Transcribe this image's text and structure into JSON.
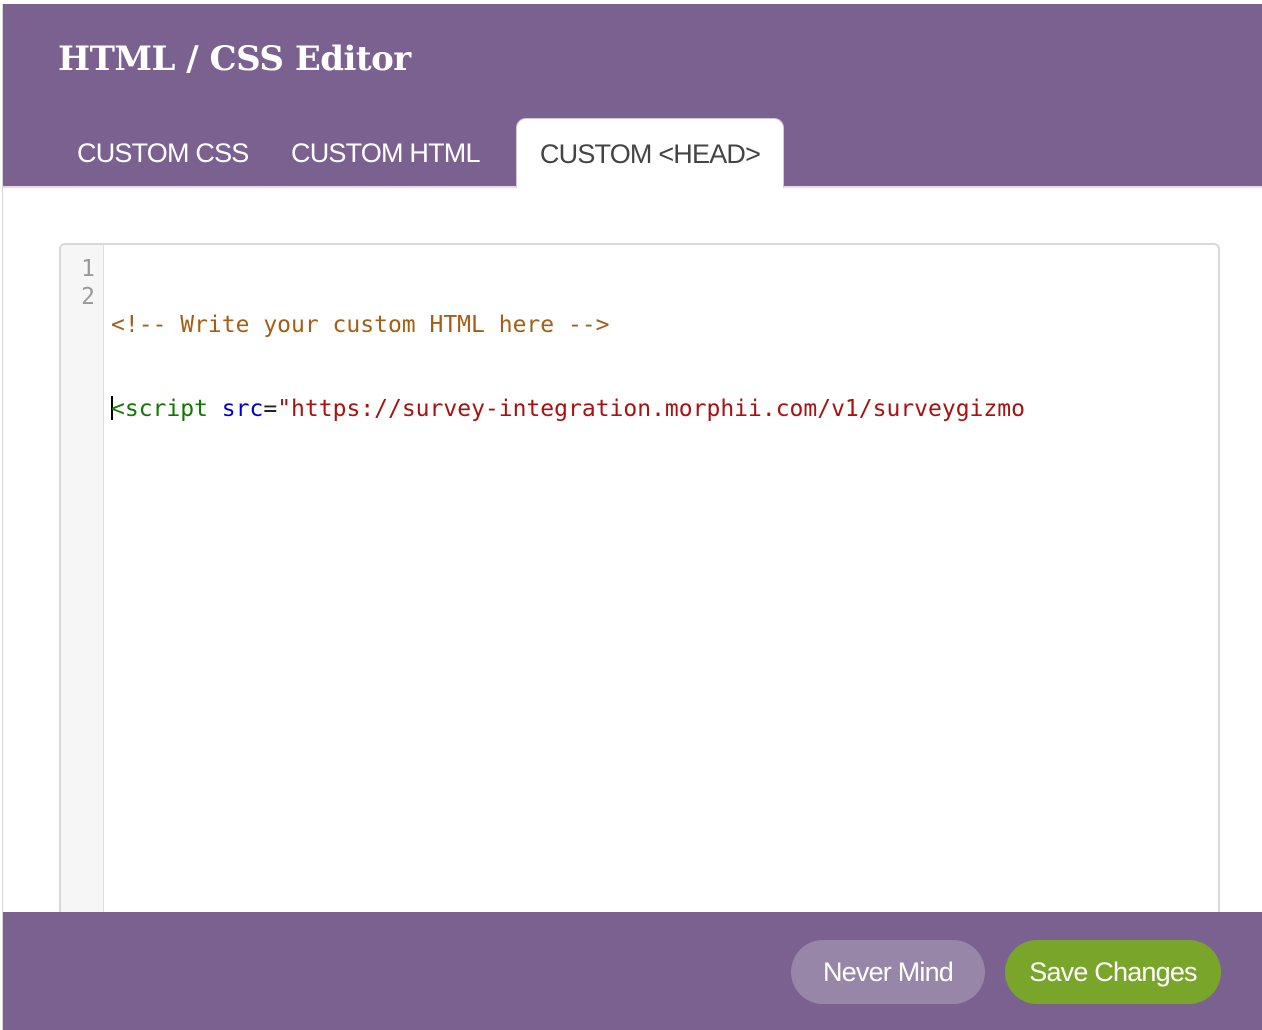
{
  "modal": {
    "title": "HTML / CSS Editor"
  },
  "tabs": [
    {
      "label": "CUSTOM CSS",
      "active": false
    },
    {
      "label": "CUSTOM HTML",
      "active": false
    },
    {
      "label": "CUSTOM <HEAD>",
      "active": true
    }
  ],
  "editor": {
    "line_numbers": [
      "1",
      "2"
    ],
    "line1": {
      "comment": "<!-- Write your custom HTML here -->"
    },
    "line2": {
      "tag_open": "<script",
      "space": " ",
      "attr_name": "src",
      "equals": "=",
      "attr_value": "\"https://survey-integration.morphii.com/v1/surveygizmo"
    }
  },
  "footer": {
    "never_mind_label": "Never Mind",
    "save_label": "Save Changes"
  },
  "colors": {
    "header_bg": "#7b6190",
    "save_button": "#79a52b",
    "never_mind_button": "#9886a8",
    "comment": "#a55e14",
    "tag": "#117700",
    "attribute": "#0000cc",
    "string": "#aa1111"
  }
}
